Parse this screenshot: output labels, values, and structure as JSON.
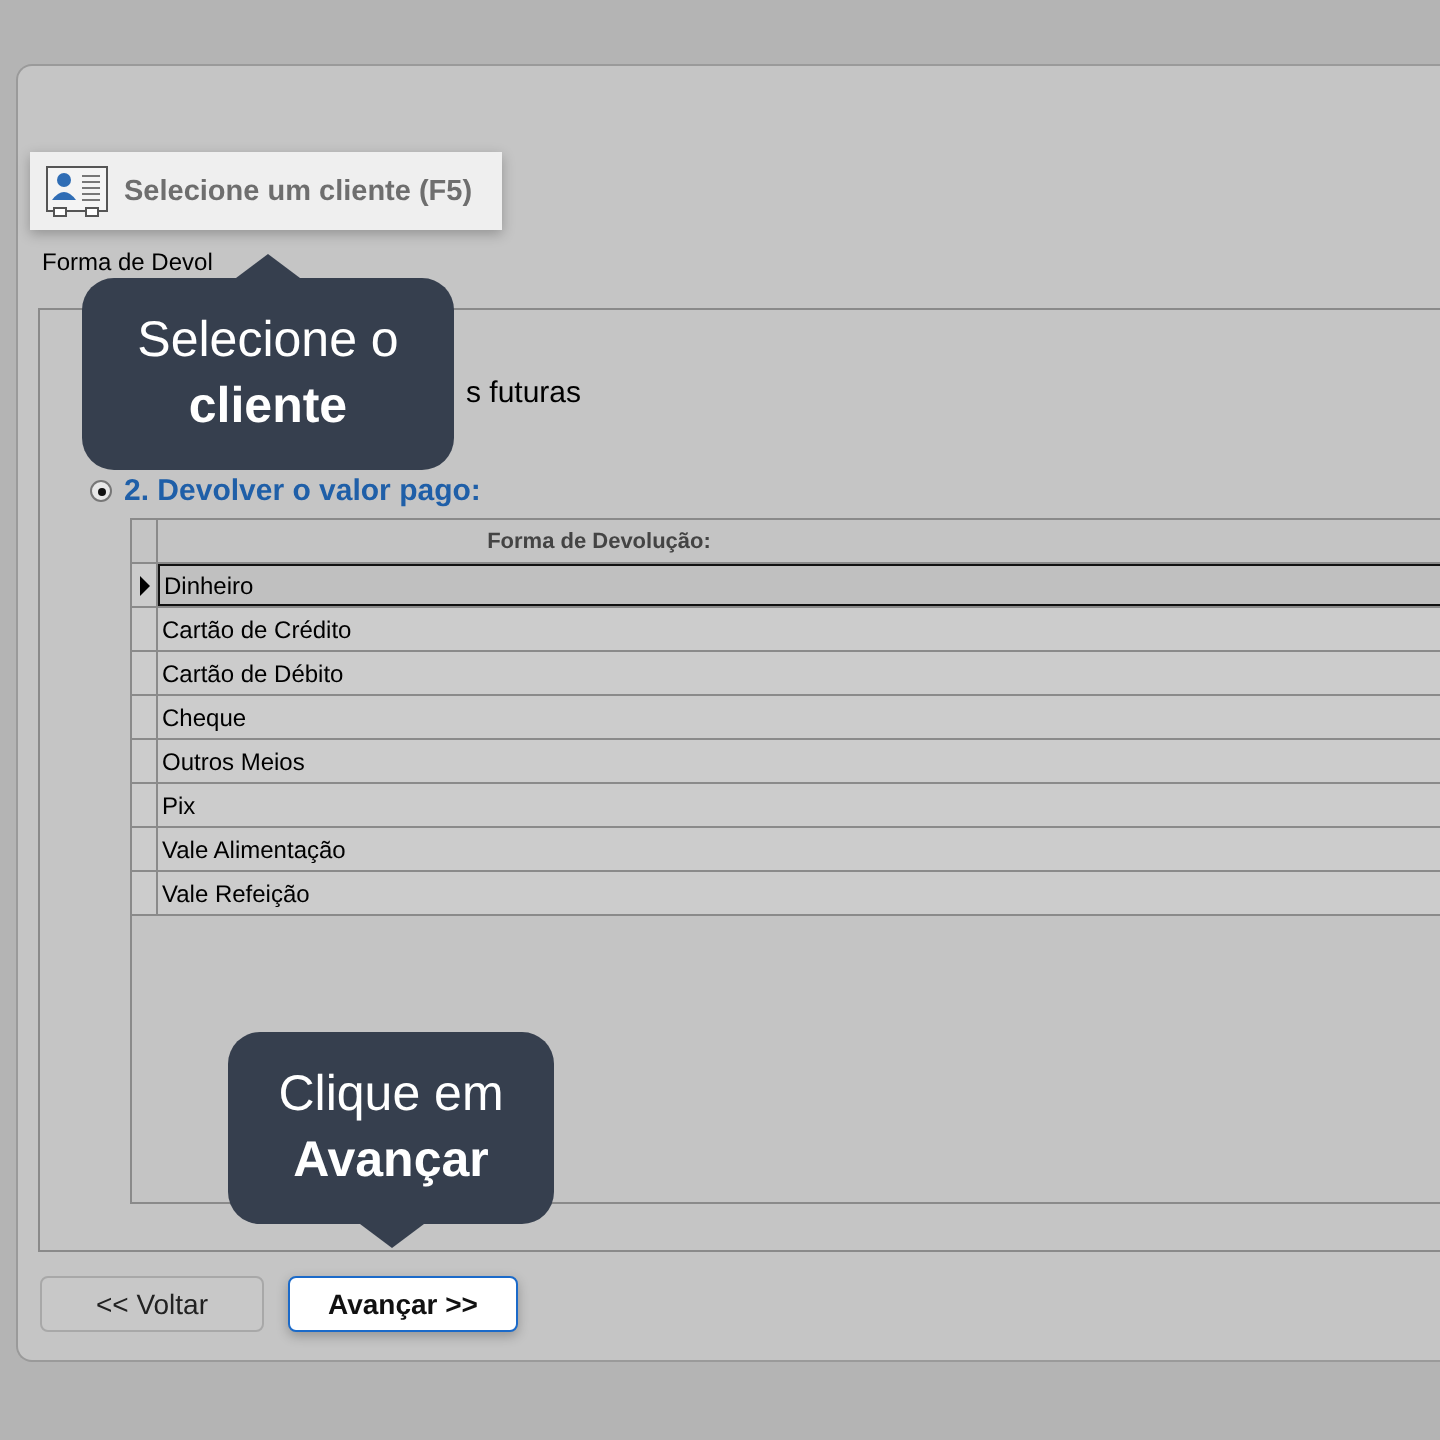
{
  "toolbar_button": {
    "label": "Selecione um cliente (F5)",
    "highlighted": true
  },
  "section_label": "Forma de Devol",
  "option_1": {
    "label": "s futuras"
  },
  "option_2": {
    "label": "2. Devolver o valor pago:",
    "selected": true
  },
  "grid": {
    "column": "Forma de Devolução:",
    "rows": [
      {
        "label": "Dinheiro",
        "selected": true
      },
      {
        "label": "Cartão de Crédito",
        "selected": false
      },
      {
        "label": "Cartão de Débito",
        "selected": false
      },
      {
        "label": "Cheque",
        "selected": false
      },
      {
        "label": "Outros Meios",
        "selected": false
      },
      {
        "label": "Pix",
        "selected": false
      },
      {
        "label": "Vale Alimentação",
        "selected": false
      },
      {
        "label": "Vale Refeição",
        "selected": false
      }
    ]
  },
  "buttons": [
    {
      "label": "<< Voltar",
      "highlighted": false
    },
    {
      "label": "Avançar >>",
      "highlighted": true
    }
  ],
  "tooltips": [
    {
      "text": "Selecione o **cliente**"
    },
    {
      "text": "Clique em **Avançar**"
    }
  ]
}
